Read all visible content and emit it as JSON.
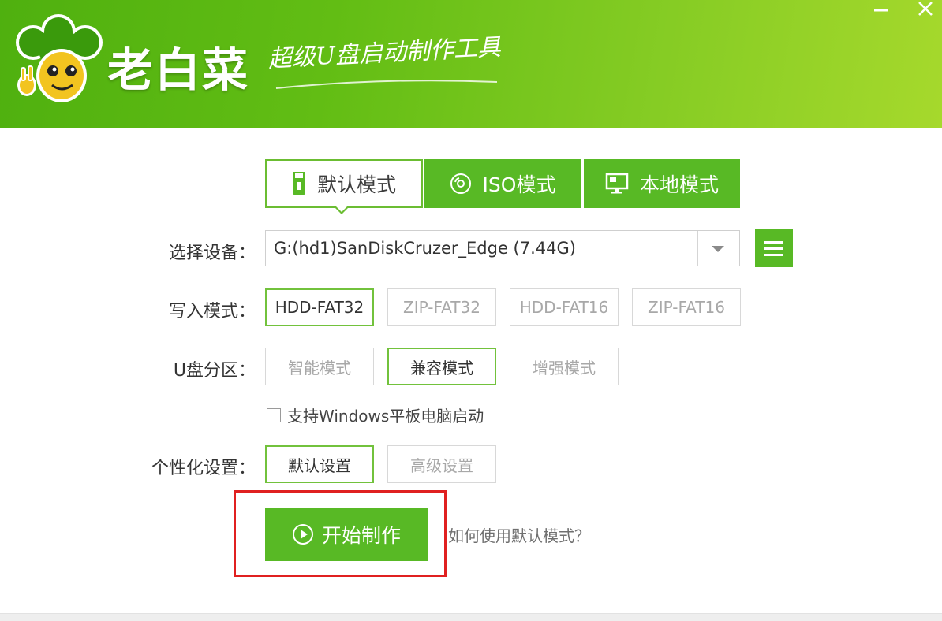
{
  "app": {
    "brand": "老白菜",
    "slogan": "超级U盘启动制作工具",
    "colors": {
      "header_green": "#62bd14",
      "accent_green": "#58b925",
      "highlight_red": "#e02020"
    }
  },
  "window_controls": {
    "minimize_icon": "minimize-icon",
    "close_icon": "close-icon"
  },
  "tabs": [
    {
      "label": "默认模式",
      "icon": "usb-drive-icon",
      "active": true
    },
    {
      "label": "ISO模式",
      "icon": "disc-icon",
      "active": false
    },
    {
      "label": "本地模式",
      "icon": "monitor-icon",
      "active": false
    }
  ],
  "device": {
    "label": "选择设备：",
    "value": "G:(hd1)SanDiskCruzer_Edge (7.44G)"
  },
  "write_mode": {
    "label": "写入模式：",
    "options": [
      "HDD-FAT32",
      "ZIP-FAT32",
      "HDD-FAT16",
      "ZIP-FAT16"
    ],
    "selected": "HDD-FAT32"
  },
  "partition": {
    "label": "U盘分区：",
    "options": [
      "智能模式",
      "兼容模式",
      "增强模式"
    ],
    "selected": "兼容模式"
  },
  "tablet_support": {
    "label": "支持Windows平板电脑启动",
    "checked": false
  },
  "personalization": {
    "label": "个性化设置：",
    "options": [
      "默认设置",
      "高级设置"
    ],
    "selected": "默认设置"
  },
  "start": {
    "label": "开始制作",
    "icon": "play-circle-icon"
  },
  "help_link": "如何使用默认模式？"
}
